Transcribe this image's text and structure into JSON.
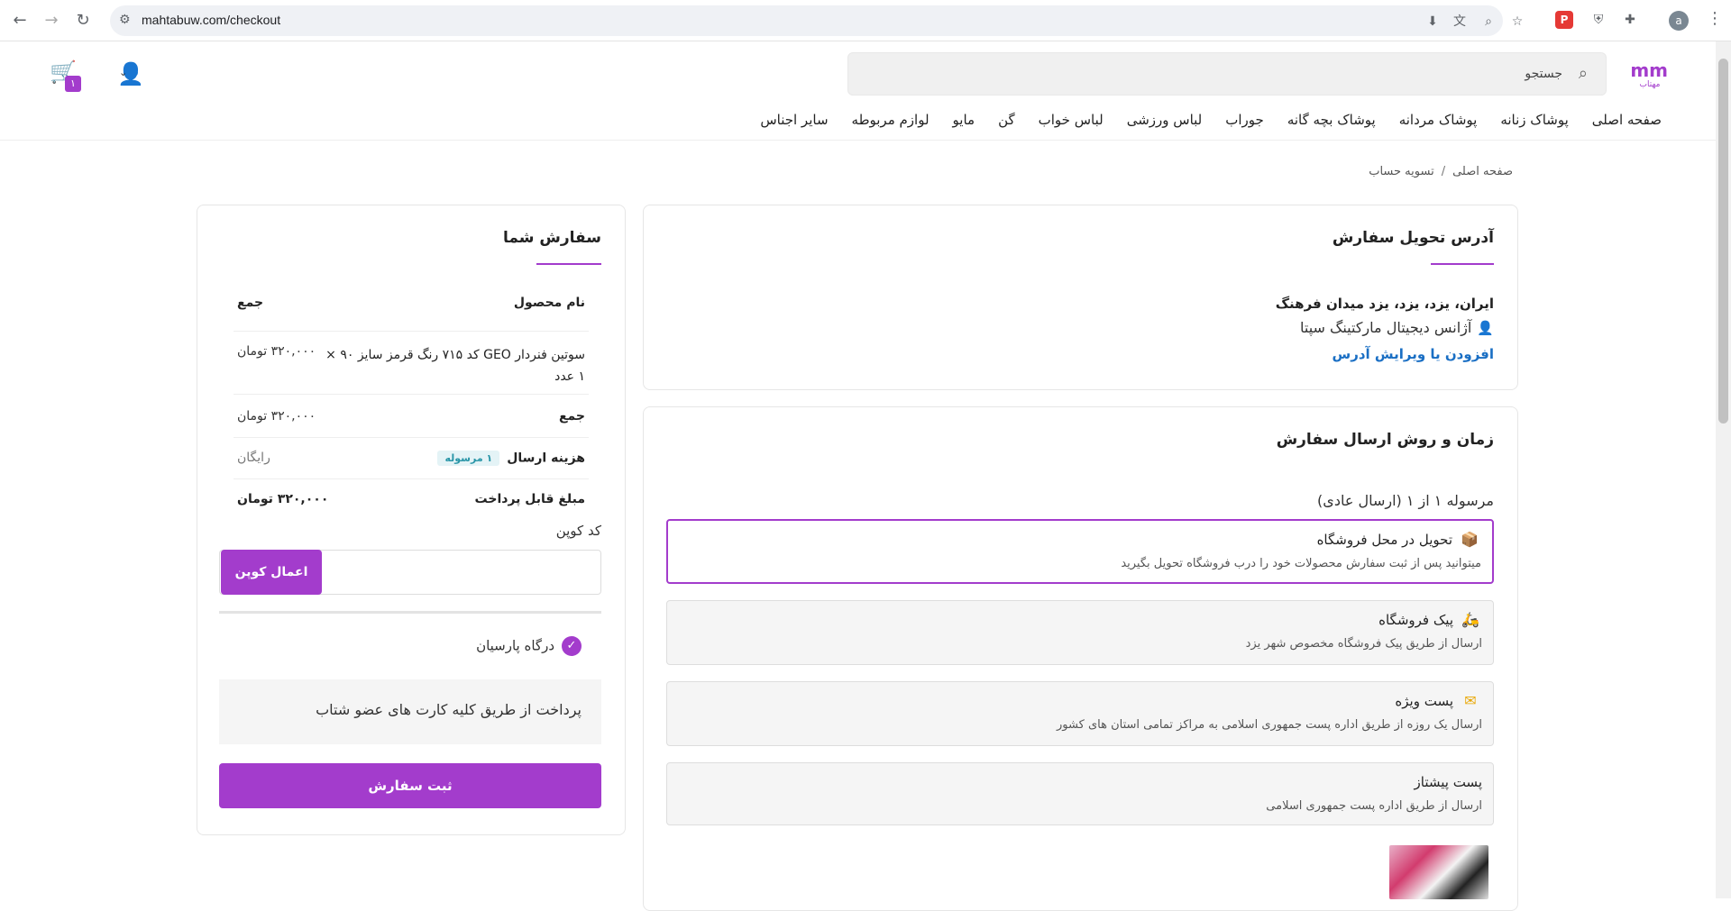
{
  "browser": {
    "url": "mahtabuw.com/checkout",
    "profile_initial": "a"
  },
  "header": {
    "logo_text": "mm",
    "logo_sub": "مهتاب",
    "search_placeholder": "جستجو",
    "cart_count": "۱",
    "menu": [
      "صفحه اصلی",
      "پوشاک زنانه",
      "پوشاک مردانه",
      "پوشاک بچه گانه",
      "جوراب",
      "لباس ورزشی",
      "لباس خواب",
      "گن",
      "مایو",
      "لوازم مربوطه",
      "سایر اجناس"
    ]
  },
  "breadcrumb": {
    "home": "صفحه اصلی",
    "sep": "/",
    "current": "تسویه حساب"
  },
  "address": {
    "title": "آدرس تحویل سفارش",
    "location": "ایران، یزد، یزد، یزد میدان فرهنگ",
    "name": "آژانس دیجیتال مارکتینگ سپتا",
    "edit_link": "افزودن یا ویرایش آدرس"
  },
  "shipping": {
    "title": "زمان و روش ارسال سفارش",
    "parcel_label": "مرسوله ۱ از ۱ (ارسال عادی)",
    "options": [
      {
        "title": "تحویل در محل فروشگاه",
        "desc": "میتوانید پس از ثبت سفارش محصولات خود را درب فروشگاه تحویل بگیرید"
      },
      {
        "title": "پیک فروشگاه",
        "desc": "ارسال از طریق پیک فروشگاه مخصوص شهر یزد"
      },
      {
        "title": "پست ویژه",
        "desc": "ارسال یک روزه از طریق اداره پست جمهوری اسلامی به مراکز تمامی استان های کشور"
      },
      {
        "title": "پست پیشتاز",
        "desc": "ارسال از طریق اداره پست جمهوری اسلامی"
      }
    ]
  },
  "order": {
    "title": "سفارش شما",
    "col_product": "نام محصول",
    "col_total": "جمع",
    "item_name": "سوتین فنردار GEO کد ۷۱۵ رنگ قرمز سایز ۹۰",
    "item_qty": "× ۱ عدد",
    "item_price": "۳۲۰,۰۰۰ تومان",
    "subtotal_label": "جمع",
    "subtotal_value": "۳۲۰,۰۰۰ تومان",
    "shipping_label": "هزینه ارسال",
    "shipping_badge": "۱ مرسوله",
    "shipping_value": "رایگان",
    "total_label": "مبلغ قابل پرداخت",
    "total_value": "۳۲۰,۰۰۰ تومان",
    "coupon_label": "کد کوپن",
    "coupon_button": "اعمال کوپن",
    "gateway": "درگاه پارسیان",
    "gateway_desc": "پرداخت از طریق کلیه کارت های عضو شتاب",
    "submit": "ثبت سفارش"
  },
  "colors": {
    "accent": "#a33ccc",
    "link": "#1a6fc4"
  }
}
